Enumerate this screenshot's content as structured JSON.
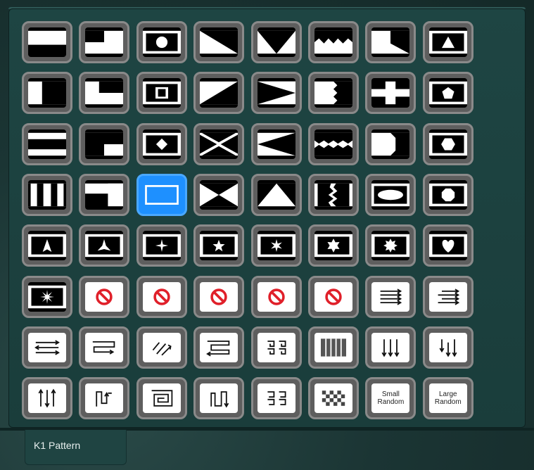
{
  "tab": {
    "label": "K1 Pattern"
  },
  "tiles": [
    {
      "name": "pattern-bar-bottom",
      "kind": "dark"
    },
    {
      "name": "pattern-corner-bottom-left",
      "kind": "dark"
    },
    {
      "name": "pattern-circle",
      "kind": "dark"
    },
    {
      "name": "pattern-triangle-diagonal",
      "kind": "dark"
    },
    {
      "name": "pattern-v-shape",
      "kind": "dark"
    },
    {
      "name": "pattern-zigzag-top",
      "kind": "dark"
    },
    {
      "name": "pattern-wedge-corner",
      "kind": "dark"
    },
    {
      "name": "pattern-triangle-up-small",
      "kind": "dark"
    },
    {
      "name": "pattern-bar-vertical",
      "kind": "dark"
    },
    {
      "name": "pattern-corner-l",
      "kind": "dark"
    },
    {
      "name": "pattern-square-inset",
      "kind": "dark"
    },
    {
      "name": "pattern-triangle-lower-right",
      "kind": "dark"
    },
    {
      "name": "pattern-arrow-right-wedge",
      "kind": "dark"
    },
    {
      "name": "pattern-zigzag-vertical",
      "kind": "dark"
    },
    {
      "name": "pattern-cross",
      "kind": "dark"
    },
    {
      "name": "pattern-pentagon",
      "kind": "dark"
    },
    {
      "name": "pattern-bars-horizontal",
      "kind": "dark"
    },
    {
      "name": "pattern-corner-step",
      "kind": "dark"
    },
    {
      "name": "pattern-diamond",
      "kind": "dark"
    },
    {
      "name": "pattern-x",
      "kind": "dark"
    },
    {
      "name": "pattern-arrow-left-wedge",
      "kind": "dark"
    },
    {
      "name": "pattern-zigzag-band",
      "kind": "dark"
    },
    {
      "name": "pattern-trapezoid",
      "kind": "dark"
    },
    {
      "name": "pattern-hexagon",
      "kind": "dark"
    },
    {
      "name": "pattern-bars-vertical",
      "kind": "dark"
    },
    {
      "name": "pattern-corner-top-right",
      "kind": "dark"
    },
    {
      "name": "pattern-rectangle-outline",
      "kind": "sel"
    },
    {
      "name": "pattern-hourglass",
      "kind": "dark"
    },
    {
      "name": "pattern-triangle-up",
      "kind": "dark"
    },
    {
      "name": "pattern-zigzag-column",
      "kind": "dark"
    },
    {
      "name": "pattern-ellipse",
      "kind": "dark"
    },
    {
      "name": "pattern-octagon",
      "kind": "dark"
    },
    {
      "name": "pattern-arrowhead",
      "kind": "dark"
    },
    {
      "name": "pattern-three-point-star",
      "kind": "dark"
    },
    {
      "name": "pattern-four-point-star",
      "kind": "dark"
    },
    {
      "name": "pattern-five-point-star",
      "kind": "dark"
    },
    {
      "name": "pattern-six-point-star",
      "kind": "dark"
    },
    {
      "name": "pattern-star-of-david",
      "kind": "dark"
    },
    {
      "name": "pattern-burst-star",
      "kind": "dark"
    },
    {
      "name": "pattern-heart",
      "kind": "dark"
    },
    {
      "name": "pattern-starburst",
      "kind": "dark"
    },
    {
      "name": "pattern-unavailable-1",
      "kind": "light"
    },
    {
      "name": "pattern-unavailable-2",
      "kind": "light"
    },
    {
      "name": "pattern-unavailable-3",
      "kind": "light"
    },
    {
      "name": "pattern-unavailable-4",
      "kind": "light"
    },
    {
      "name": "pattern-unavailable-5",
      "kind": "light"
    },
    {
      "name": "order-lines-right",
      "kind": "light"
    },
    {
      "name": "order-lines-right-stagger",
      "kind": "light"
    },
    {
      "name": "order-alternate",
      "kind": "light"
    },
    {
      "name": "order-snake",
      "kind": "light"
    },
    {
      "name": "order-diagonal",
      "kind": "light"
    },
    {
      "name": "order-snake-offset",
      "kind": "light"
    },
    {
      "name": "order-quadrant-spiral",
      "kind": "light"
    },
    {
      "name": "order-columns",
      "kind": "light"
    },
    {
      "name": "order-down",
      "kind": "light"
    },
    {
      "name": "order-down-stagger",
      "kind": "light"
    },
    {
      "name": "order-up-down",
      "kind": "light"
    },
    {
      "name": "order-snake-vertical",
      "kind": "light"
    },
    {
      "name": "order-spiral",
      "kind": "light"
    },
    {
      "name": "order-snake-vertical-2",
      "kind": "light"
    },
    {
      "name": "order-quadrant-spiral-2",
      "kind": "light"
    },
    {
      "name": "order-checker",
      "kind": "light"
    },
    {
      "name": "order-small-random",
      "kind": "light",
      "label": "Small\nRandom"
    },
    {
      "name": "order-large-random",
      "kind": "light",
      "label": "Large\nRandom"
    }
  ]
}
